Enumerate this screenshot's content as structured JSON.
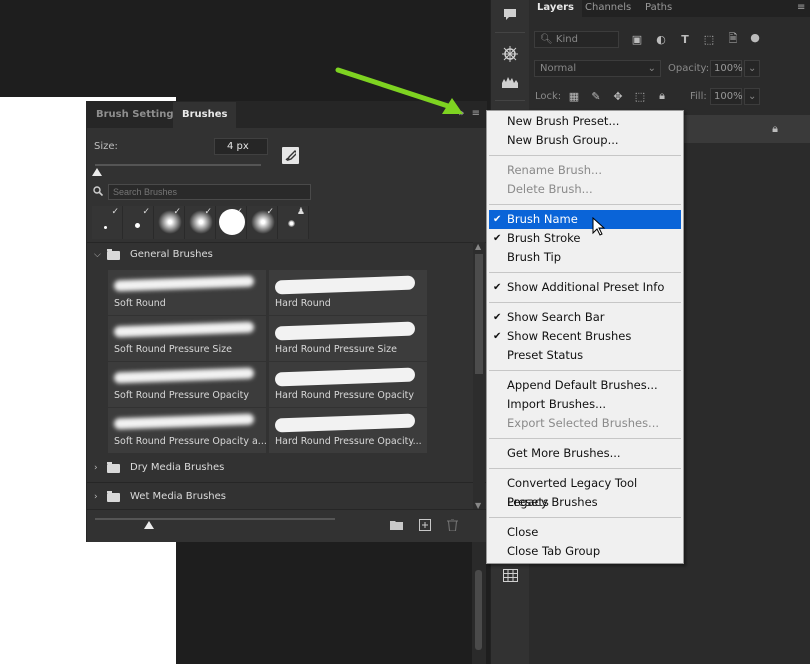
{
  "layers_panel": {
    "tabs": [
      "Layers",
      "Channels",
      "Paths"
    ],
    "kind_filter": "Kind",
    "blend_mode": "Normal",
    "opacity_label": "Opacity:",
    "opacity_value": "100%",
    "lock_label": "Lock:",
    "fill_label": "Fill:",
    "fill_value": "100%"
  },
  "brushes_panel": {
    "tabs": [
      "Brush Settings",
      "Brushes"
    ],
    "active_tab": "Brushes",
    "size_label": "Size:",
    "size_value": "4 px",
    "search_placeholder": "Search Brushes",
    "groups": [
      {
        "name": "General Brushes",
        "expanded": true
      },
      {
        "name": "Dry Media Brushes",
        "expanded": false
      },
      {
        "name": "Wet Media Brushes",
        "expanded": false
      }
    ],
    "brushes": [
      "Soft Round",
      "Hard Round",
      "Soft Round Pressure Size",
      "Hard Round Pressure Size",
      "Soft Round Pressure Opacity",
      "Hard Round Pressure Opacity",
      "Soft Round Pressure Opacity a...",
      "Hard Round Pressure Opacity..."
    ]
  },
  "menu": {
    "items": [
      {
        "label": "New Brush Preset...",
        "checked": false,
        "disabled": false
      },
      {
        "label": "New Brush Group...",
        "checked": false,
        "disabled": false
      },
      {
        "label": "Rename Brush...",
        "checked": false,
        "disabled": true
      },
      {
        "label": "Delete Brush...",
        "checked": false,
        "disabled": true
      },
      {
        "label": "Brush Name",
        "checked": true,
        "disabled": false,
        "highlighted": true
      },
      {
        "label": "Brush Stroke",
        "checked": true,
        "disabled": false
      },
      {
        "label": "Brush Tip",
        "checked": false,
        "disabled": false
      },
      {
        "label": "Show Additional Preset Info",
        "checked": true,
        "disabled": false
      },
      {
        "label": "Show Search Bar",
        "checked": true,
        "disabled": false
      },
      {
        "label": "Show Recent Brushes",
        "checked": true,
        "disabled": false
      },
      {
        "label": "Preset Status",
        "checked": false,
        "disabled": false
      },
      {
        "label": "Append Default Brushes...",
        "checked": false,
        "disabled": false
      },
      {
        "label": "Import Brushes...",
        "checked": false,
        "disabled": false
      },
      {
        "label": "Export Selected Brushes...",
        "checked": false,
        "disabled": true
      },
      {
        "label": "Get More Brushes...",
        "checked": false,
        "disabled": false
      },
      {
        "label": "Converted Legacy Tool Presets",
        "checked": false,
        "disabled": false
      },
      {
        "label": "Legacy Brushes",
        "checked": false,
        "disabled": false
      },
      {
        "label": "Close",
        "checked": false,
        "disabled": false
      },
      {
        "label": "Close Tab Group",
        "checked": false,
        "disabled": false
      }
    ],
    "check_glyph": "✔"
  },
  "colors": {
    "highlight": "#0a64d8",
    "annotation_arrow": "#7ed321"
  }
}
